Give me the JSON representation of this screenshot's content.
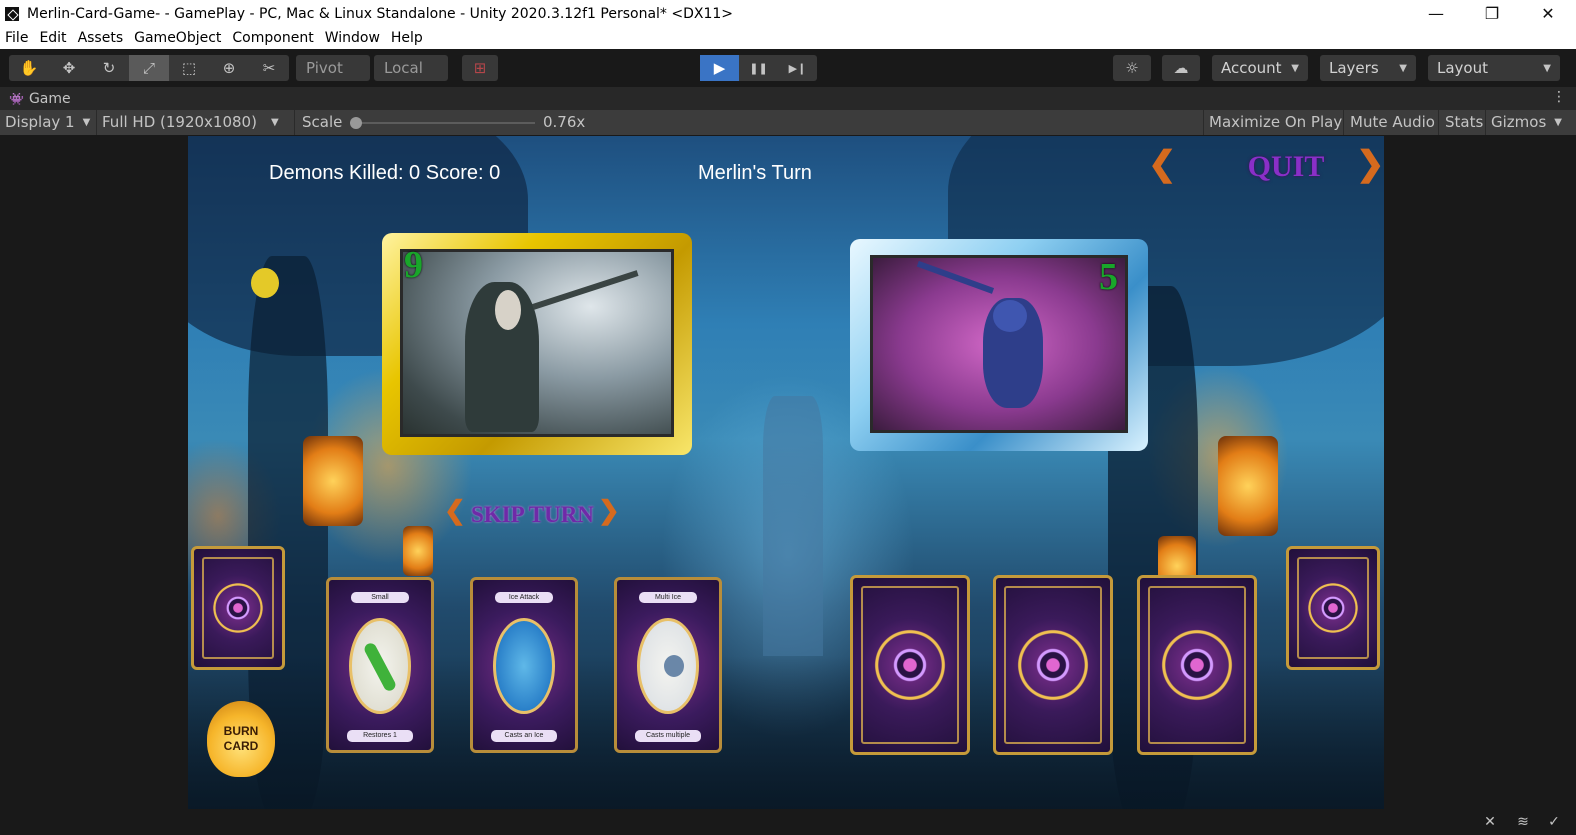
{
  "window": {
    "title": "Merlin-Card-Game- - GamePlay - PC, Mac & Linux Standalone - Unity 2020.3.12f1 Personal* <DX11>",
    "minimize": "—",
    "restore": "❐",
    "close": "✕"
  },
  "menu": [
    "File",
    "Edit",
    "Assets",
    "GameObject",
    "Component",
    "Window",
    "Help"
  ],
  "toolbar": {
    "tools": [
      {
        "name": "hand-tool",
        "glyph": "✋"
      },
      {
        "name": "move-tool",
        "glyph": "✥"
      },
      {
        "name": "rotate-tool",
        "glyph": "↻"
      },
      {
        "name": "scale-tool",
        "glyph": "⤢"
      },
      {
        "name": "rect-tool",
        "glyph": "⬚"
      },
      {
        "name": "transform-tool",
        "glyph": "⊕"
      },
      {
        "name": "custom-tool",
        "glyph": "✂"
      }
    ],
    "pivot": "Pivot",
    "local": "Local",
    "grid_glyph": "⊞",
    "play": "▶",
    "pause": "❚❚",
    "step": "▶❙",
    "account": "Account",
    "layers": "Layers",
    "layout": "Layout",
    "collab_glyph": "☼",
    "cloud_glyph": "☁"
  },
  "tab": {
    "label": "Game",
    "icon": "👾",
    "kebab": "⋮"
  },
  "gamebar": {
    "display": "Display 1",
    "resolution": "Full HD (1920x1080)",
    "scale_label": "Scale",
    "scale_value": "0.76x",
    "maximize_on_play": "Maximize On Play",
    "mute_audio": "Mute Audio",
    "stats": "Stats",
    "gizmos": "Gizmos"
  },
  "game": {
    "hud_left": "Demons Killed: 0  Score: 0",
    "turn": "Merlin's Turn",
    "quit": "QUIT",
    "skip": "SKIP TURN",
    "player_card_value": "9",
    "enemy_card_value": "5",
    "burn_line1": "BURN",
    "burn_line2": "CARD",
    "hand": [
      {
        "name": "Small",
        "desc": "Restores 1"
      },
      {
        "name": "Ice Attack",
        "desc": "Casts an Ice"
      },
      {
        "name": "Multi Ice",
        "desc": "Casts multiple"
      }
    ]
  },
  "colors": {
    "unity_dark": "#191919",
    "play_active": "#3a74c5",
    "quit_purple": "#8a2fc8",
    "card_gold": "#e8c500",
    "card_number_green": "#19a62a"
  }
}
